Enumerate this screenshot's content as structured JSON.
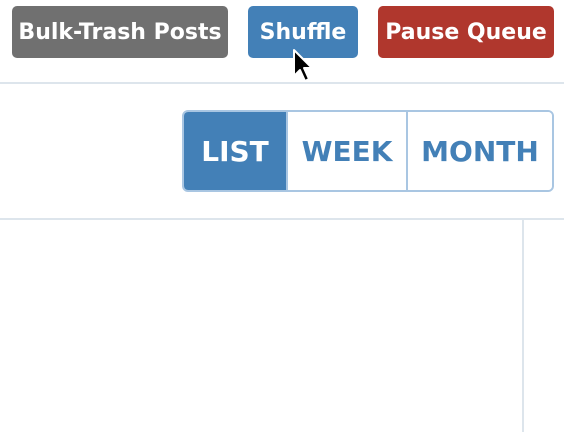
{
  "toolbar": {
    "bulk_trash_label": "Bulk-Trash Posts",
    "shuffle_label": "Shuffle",
    "pause_label": "Pause Queue"
  },
  "view_switch": {
    "list_label": "LIST",
    "week_label": "WEEK",
    "month_label": "MONTH",
    "selected": "LIST"
  },
  "colors": {
    "bulk_trash_bg": "#707070",
    "shuffle_bg": "#4380b7",
    "pause_bg": "#b0372d",
    "active_view_bg": "#4380b7",
    "inactive_view_text": "#4380b7",
    "switch_border": "#a9c6e2",
    "divider": "#dde5ec"
  },
  "cursor": {
    "icon": "mouse-pointer-icon"
  }
}
